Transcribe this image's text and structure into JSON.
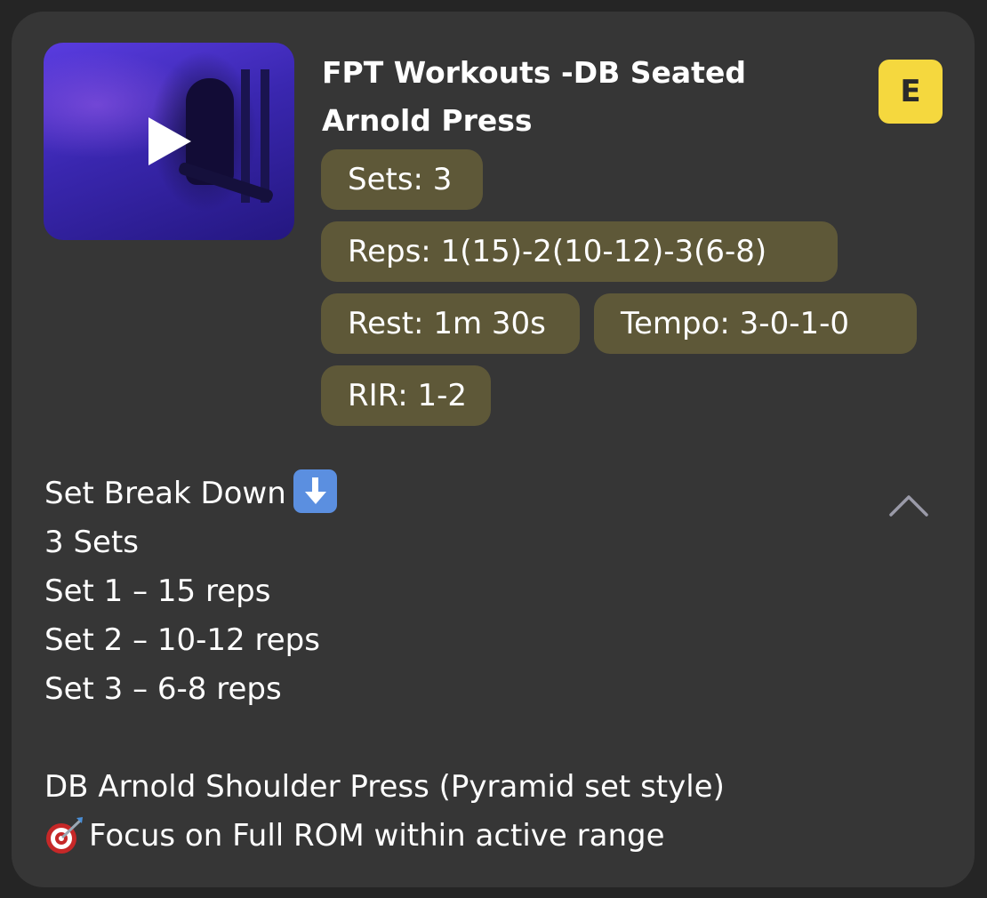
{
  "card": {
    "title": "FPT Workouts -DB Seated Arnold Press",
    "badge": "E",
    "colors": {
      "card_bg": "#363636",
      "pill_bg": "#5e5838",
      "badge_bg": "#f5d83e"
    },
    "video_thumbnail": {
      "icon": "play-icon"
    },
    "pills": {
      "sets": "Sets: 3",
      "reps": "Reps: 1(15)-2(10-12)-3(6-8)",
      "rest": "Rest: 1m 30s",
      "tempo": "Tempo: 3-0-1-0",
      "rir": "RIR: 1-2"
    },
    "description": {
      "heading": "Set Break Down",
      "heading_icon": "down-arrow-emoji",
      "lines": [
        "3 Sets",
        "Set 1 – 15 reps",
        "Set 2 – 10-12 reps",
        "Set 3 – 6-8 reps",
        "",
        "DB Arnold Shoulder Press (Pyramid set style)",
        "Focus on Full ROM within active range"
      ],
      "focus_icon": "target-emoji"
    },
    "collapse_icon": "chevron-up-icon"
  }
}
